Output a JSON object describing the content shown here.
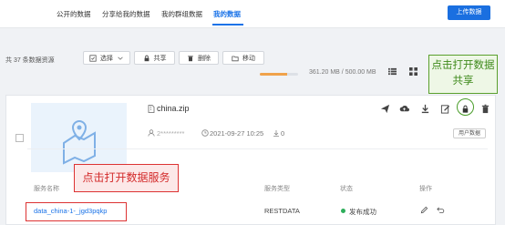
{
  "nav": {
    "tabs": [
      "公开的数据",
      "分享给我的数据",
      "我的群组数据",
      "我的数据"
    ],
    "active_tab": "我的数据",
    "upload_label": "上传数据"
  },
  "toolbar": {
    "total": "共 37 条数据资源",
    "select_label": "选择",
    "share_label": "共享",
    "delete_label": "删除",
    "move_label": "移动"
  },
  "storage": {
    "text": "361.20 MB / 500.00 MB",
    "used_fraction": 0.722
  },
  "file": {
    "name": "china.zip",
    "owner": "2*********",
    "date": "2021-09-27 10:25",
    "downloads": "0",
    "badge": "用户数据"
  },
  "services_table": {
    "headers": [
      "服务名称",
      "服务类型",
      "状态",
      "操作"
    ],
    "rows": [
      {
        "name": "data_china-1-_jgd3pqkp",
        "type": "RESTDATA",
        "status": "发布成功"
      }
    ]
  },
  "annotations": {
    "open_service": "点击打开数据服务",
    "open_share": "点击打开数据共享"
  },
  "colors": {
    "accent": "#1a73e8",
    "annotation_red": "#d33333",
    "annotation_green": "#4a9d2a",
    "success": "#2eae5b",
    "storage": "#f0a24a"
  }
}
